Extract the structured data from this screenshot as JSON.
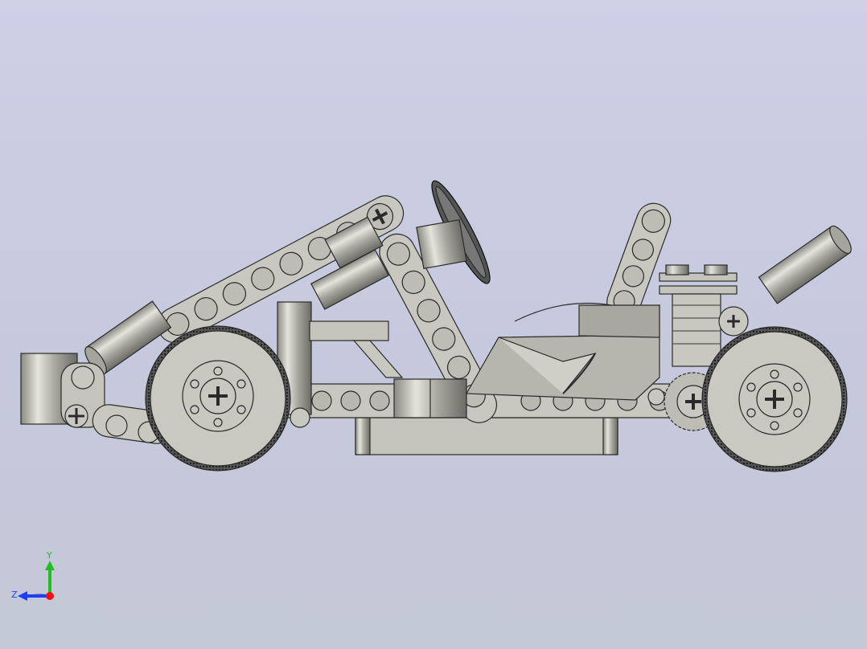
{
  "viewport": {
    "background_top": "#cfcfe6",
    "background_bottom": "#c3c8d6"
  },
  "model": {
    "name": "lego-technic-go-kart",
    "render_style": "shaded-with-edges",
    "part_color": "#c8c8c0",
    "edge_color": "#2a2a2a",
    "tire_color": "#c9c9c1"
  },
  "triad": {
    "y_label": "Y",
    "z_label": "Z",
    "y_color": "#1fbf1f",
    "z_color": "#1f3fff",
    "x_color": "#ee1111"
  }
}
